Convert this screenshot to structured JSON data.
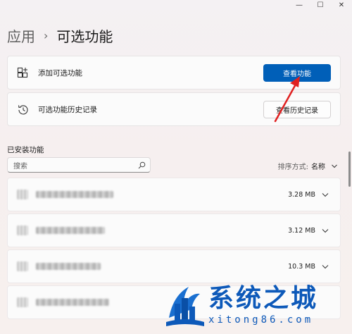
{
  "window": {
    "controls": [
      "—",
      "☐",
      "✕"
    ]
  },
  "breadcrumb": {
    "parent": "应用",
    "separator": "›",
    "current": "可选功能"
  },
  "add_card": {
    "label": "添加可选功能",
    "button_label": "查看功能"
  },
  "history_card": {
    "label": "可选功能历史记录",
    "button_label": "查看历史记录"
  },
  "installed": {
    "title": "已安装功能",
    "search_placeholder": "搜索",
    "sort_label": "排序方式:",
    "sort_value": "名称",
    "items": [
      {
        "size": "3.28 MB"
      },
      {
        "size": "3.12 MB"
      },
      {
        "size": "10.3 MB"
      },
      {
        "size": ""
      }
    ]
  },
  "watermark": {
    "main": "系统之城",
    "sub": "xitong86.com"
  },
  "colors": {
    "accent": "#005fb8",
    "arrow": "#e02020",
    "watermark": "#0d59b9"
  }
}
